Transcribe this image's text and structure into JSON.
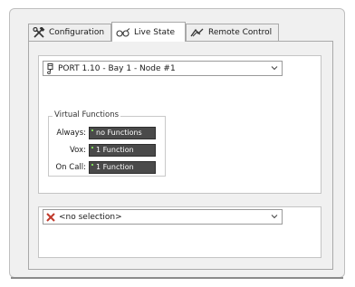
{
  "tabs": [
    {
      "label": "Configuration",
      "icon": "hammer-wrench-icon",
      "active": false
    },
    {
      "label": "Live State",
      "icon": "glasses-icon",
      "active": true
    },
    {
      "label": "Remote Control",
      "icon": "remote-control-icon",
      "active": false
    }
  ],
  "node_selector": {
    "value": "PORT 1.10 - Bay 1 - Node #1",
    "icon": "port-node-icon"
  },
  "virtual_functions": {
    "title": "Virtual Functions",
    "rows": [
      {
        "label": "Always:",
        "value": "no Functions"
      },
      {
        "label": "Vox:",
        "value": "1 Function"
      },
      {
        "label": "On Call:",
        "value": "1 Function"
      }
    ]
  },
  "secondary_selector": {
    "value": "<no selection>",
    "icon": "red-x-icon"
  },
  "colors": {
    "window_bg": "#f0f0f0",
    "value_box_bg": "#4a4a4a",
    "indicator_green": "#7ed957",
    "x_red": "#c0392b"
  }
}
